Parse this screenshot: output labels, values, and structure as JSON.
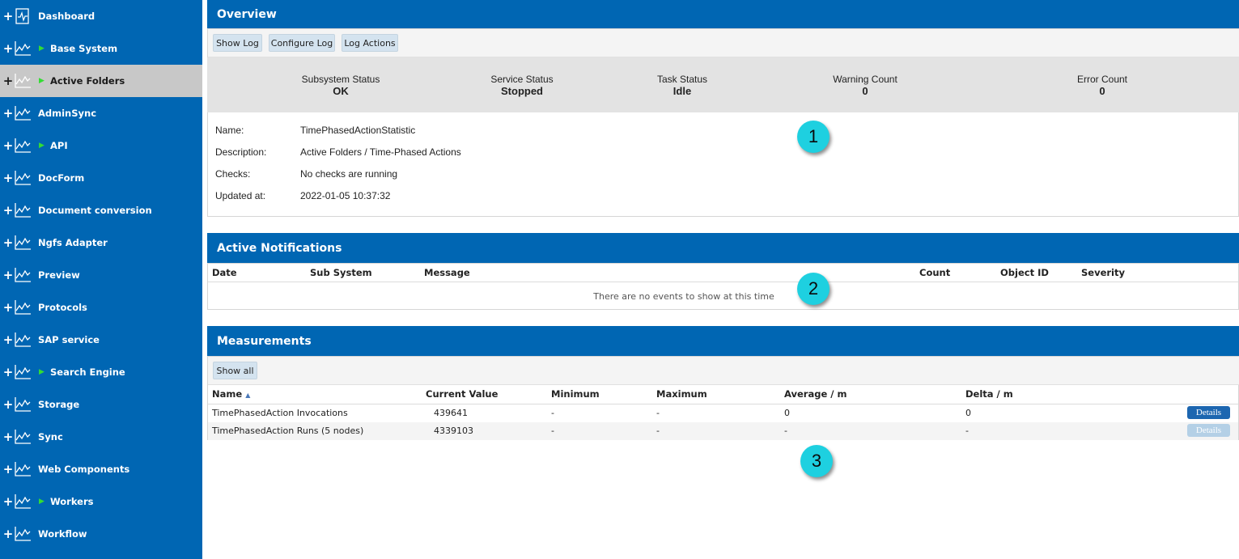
{
  "sidebar": {
    "items": [
      {
        "label": "Dashboard",
        "expanded": false,
        "active": false
      },
      {
        "label": "Base System",
        "expanded": true,
        "active": false
      },
      {
        "label": "Active Folders",
        "expanded": true,
        "active": true
      },
      {
        "label": "AdminSync",
        "expanded": false,
        "active": false
      },
      {
        "label": "API",
        "expanded": true,
        "active": false
      },
      {
        "label": "DocForm",
        "expanded": false,
        "active": false
      },
      {
        "label": "Document conversion",
        "expanded": false,
        "active": false
      },
      {
        "label": "Ngfs Adapter",
        "expanded": false,
        "active": false
      },
      {
        "label": "Preview",
        "expanded": false,
        "active": false
      },
      {
        "label": "Protocols",
        "expanded": false,
        "active": false
      },
      {
        "label": "SAP service",
        "expanded": false,
        "active": false
      },
      {
        "label": "Search Engine",
        "expanded": true,
        "active": false
      },
      {
        "label": "Storage",
        "expanded": false,
        "active": false
      },
      {
        "label": "Sync",
        "expanded": false,
        "active": false
      },
      {
        "label": "Web Components",
        "expanded": false,
        "active": false
      },
      {
        "label": "Workers",
        "expanded": true,
        "active": false
      },
      {
        "label": "Workflow",
        "expanded": false,
        "active": false
      }
    ],
    "plus_symbol": "+",
    "arrow_symbol": "▶"
  },
  "overview": {
    "title": "Overview",
    "buttons": {
      "show_log": "Show Log",
      "configure_log": "Configure Log",
      "log_actions": "Log Actions"
    },
    "status": [
      {
        "title": "Subsystem Status",
        "value": "OK"
      },
      {
        "title": "Service Status",
        "value": "Stopped"
      },
      {
        "title": "Task Status",
        "value": "Idle"
      },
      {
        "title": "Warning Count",
        "value": "0"
      },
      {
        "title": "Error Count",
        "value": "0"
      }
    ],
    "info": [
      {
        "label": "Name:",
        "value": "TimePhasedActionStatistic"
      },
      {
        "label": "Description:",
        "value": "Active Folders / Time-Phased Actions"
      },
      {
        "label": "Checks:",
        "value": "No checks are running"
      },
      {
        "label": "Updated at:",
        "value": "2022-01-05 10:37:32"
      }
    ]
  },
  "notifications": {
    "title": "Active Notifications",
    "columns": [
      "Date",
      "Sub System",
      "Message",
      "Count",
      "Object ID",
      "Severity"
    ],
    "empty_text": "There are no events to show at this time"
  },
  "measurements": {
    "title": "Measurements",
    "show_all": "Show all",
    "columns": [
      "Name",
      "Current Value",
      "Minimum",
      "Maximum",
      "Average / m",
      "Delta / m"
    ],
    "sort_indicator": "▲",
    "rows": [
      {
        "name": "TimePhasedAction Invocations",
        "current": "439641",
        "min": "-",
        "max": "-",
        "avg": "0",
        "delta": "0",
        "details": "Details",
        "details_enabled": true
      },
      {
        "name": "TimePhasedAction Runs (5 nodes)",
        "current": "4339103",
        "min": "-",
        "max": "-",
        "avg": "-",
        "delta": "-",
        "details": "Details",
        "details_enabled": false
      }
    ]
  },
  "callouts": [
    "1",
    "2",
    "3"
  ],
  "colors": {
    "brand_blue": "#0066b3",
    "callout_cyan": "#1ed0e0",
    "active_item_bg": "#c8c8c8",
    "arrow_green": "#33dd33"
  }
}
